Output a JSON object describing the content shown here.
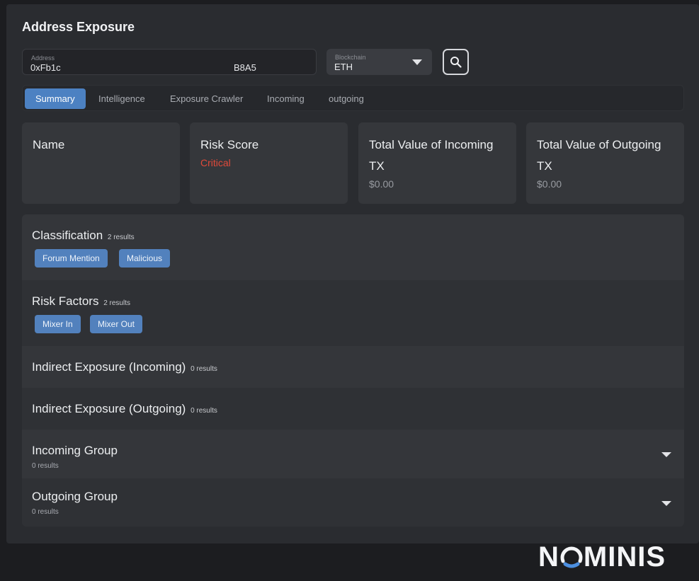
{
  "page": {
    "title": "Address Exposure"
  },
  "search": {
    "address_label": "Address",
    "address_prefix": "0xFb1c",
    "address_suffix": "B8A5",
    "blockchain_label": "Blockchain",
    "blockchain_value": "ETH"
  },
  "tabs": [
    {
      "label": "Summary",
      "active": true
    },
    {
      "label": "Intelligence",
      "active": false
    },
    {
      "label": "Exposure Crawler",
      "active": false
    },
    {
      "label": "Incoming",
      "active": false
    },
    {
      "label": "outgoing",
      "active": false
    }
  ],
  "cards": {
    "name": {
      "title": "Name"
    },
    "risk": {
      "title": "Risk Score",
      "value": "Critical"
    },
    "incoming": {
      "title": "Total Value of Incoming TX",
      "value": "$0.00"
    },
    "outgoing": {
      "title": "Total Value of Outgoing TX",
      "value": "$0.00"
    }
  },
  "sections": {
    "classification": {
      "title": "Classification",
      "count": "2 results",
      "chips": [
        "Forum Mention",
        "Malicious"
      ]
    },
    "risk_factors": {
      "title": "Risk Factors",
      "count": "2 results",
      "chips": [
        "Mixer In",
        "Mixer Out"
      ]
    },
    "indirect_in": {
      "title": "Indirect Exposure (Incoming)",
      "count": "0 results"
    },
    "indirect_out": {
      "title": "Indirect Exposure (Outgoing)",
      "count": "0 results"
    },
    "incoming_group": {
      "title": "Incoming Group",
      "count": "0 results"
    },
    "outgoing_group": {
      "title": "Outgoing Group",
      "count": "0 results"
    }
  },
  "brand": {
    "logo_text": "NOMINIS",
    "logo_before": "N",
    "logo_after": "MINIS"
  },
  "colors": {
    "accent": "#4c81c2",
    "chip": "#5281bd",
    "critical": "#e04a3a"
  },
  "icons": {
    "search": "search-icon",
    "dropdown": "chevron-down-icon"
  }
}
